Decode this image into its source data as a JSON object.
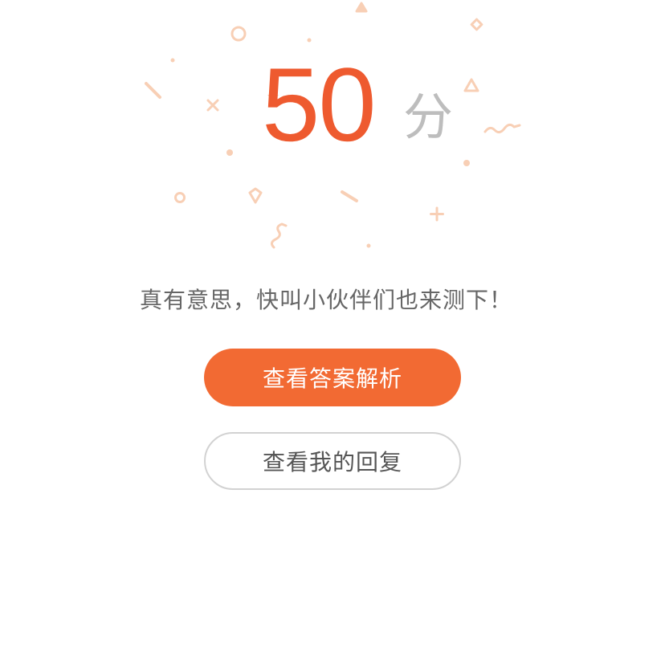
{
  "colors": {
    "accent": "#ee5a2f",
    "button_primary_bg": "#f26a33",
    "unit_gray": "#bdbdbd",
    "subtitle_text": "#666666",
    "secondary_text": "#555555",
    "confetti": "#f8cfb5"
  },
  "result": {
    "score": "50",
    "unit": "分"
  },
  "message": "真有意思，快叫小伙伴们也来测下！",
  "buttons": {
    "view_analysis": "查看答案解析",
    "view_my_reply": "查看我的回复"
  }
}
